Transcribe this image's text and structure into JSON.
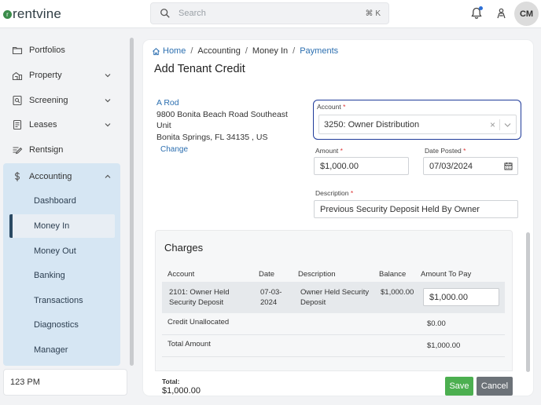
{
  "app": {
    "brand": "rentvine",
    "brand_mark": "r"
  },
  "header": {
    "search_placeholder": "Search",
    "search_shortcut": "⌘ K",
    "avatar_initials": "CM"
  },
  "sidebar": {
    "items": [
      {
        "label": "Portfolios",
        "icon": "folder-icon"
      },
      {
        "label": "Property",
        "icon": "building-icon"
      },
      {
        "label": "Screening",
        "icon": "screening-icon"
      },
      {
        "label": "Leases",
        "icon": "document-icon"
      },
      {
        "label": "Rentsign",
        "icon": "signature-icon"
      },
      {
        "label": "Accounting",
        "icon": "dollar-icon"
      }
    ],
    "accounting_children": [
      "Dashboard",
      "Money In",
      "Money Out",
      "Banking",
      "Transactions",
      "Diagnostics",
      "Manager"
    ],
    "active_child": "Money In",
    "clock": "123 PM"
  },
  "breadcrumb": {
    "home": "Home",
    "level1": "Accounting",
    "level2": "Money In",
    "current": "Payments"
  },
  "page_title": "Add Tenant Credit",
  "tenant": {
    "name": "A Rod",
    "address_line1": "9800 Bonita Beach Road Southeast",
    "address_line2": "Unit",
    "address_line3": "Bonita Springs, FL 34135 , US",
    "change_label": "Change"
  },
  "form": {
    "account_label": "Account",
    "account_value": "3250: Owner Distribution",
    "amount_label": "Amount",
    "amount_value": "$1,000.00",
    "date_label": "Date Posted",
    "date_value": "07/03/2024",
    "description_label": "Description",
    "description_value": "Previous Security Deposit Held By Owner",
    "required_mark": "*"
  },
  "charges": {
    "title": "Charges",
    "columns": [
      "Account",
      "Date",
      "Description",
      "Balance",
      "Amount To Pay"
    ],
    "rows": [
      {
        "account_l1": "2101: Owner Held",
        "account_l2": "Security Deposit",
        "date_l1": "07-03-",
        "date_l2": "2024",
        "desc_l1": "Owner Held Security",
        "desc_l2": "Deposit",
        "balance": "$1,000.00",
        "amount_to_pay": "$1,000.00"
      }
    ],
    "credit_unallocated_label": "Credit Unallocated",
    "credit_unallocated_value": "$0.00",
    "total_amount_label": "Total Amount",
    "total_amount_value": "$1,000.00"
  },
  "footer": {
    "total_label": "Total:",
    "total_value": "$1,000.00",
    "save_label": "Save",
    "cancel_label": "Cancel"
  },
  "colors": {
    "accent": "#2c6fb0",
    "focus_border": "#1f3b9a",
    "save": "#4caf50",
    "cancel": "#6c7278",
    "nav_active_bg": "#d6e6f3"
  }
}
